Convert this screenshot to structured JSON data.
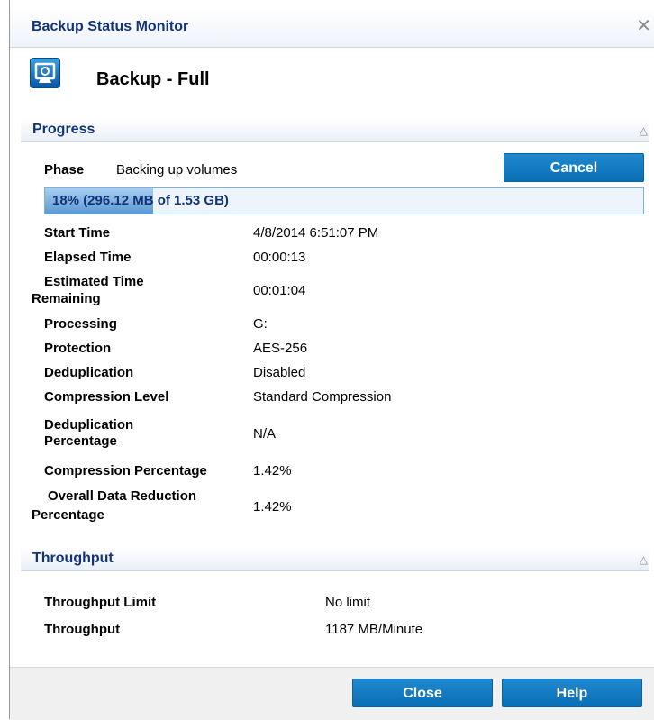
{
  "window": {
    "title": "Backup Status Monitor"
  },
  "header": {
    "title": "Backup - Full"
  },
  "progress_section": {
    "label": "Progress",
    "phase_label": "Phase",
    "phase_value": "Backing up volumes",
    "cancel_label": "Cancel",
    "progress_text": "18% (296.12 MB of 1.53 GB)",
    "progress_fraction": 0.18,
    "fields": [
      {
        "label": "Start Time",
        "value": "4/8/2014 6:51:07 PM"
      },
      {
        "label": "Elapsed Time",
        "value": "00:00:13"
      },
      {
        "label_line1": "Estimated Time",
        "label_line2": "Remaining",
        "value": "00:01:04"
      },
      {
        "label": "Processing",
        "value": "G:"
      },
      {
        "label": "Protection",
        "value": "AES-256"
      },
      {
        "label": "Deduplication",
        "value": "Disabled"
      },
      {
        "label": "Compression Level",
        "value": "Standard Compression"
      },
      {
        "label_line1": "Deduplication",
        "label_line2": "Percentage",
        "value": "N/A"
      },
      {
        "label": "Compression Percentage",
        "value": "1.42%"
      },
      {
        "label_line1": "Overall Data Reduction",
        "label_line2": "Percentage",
        "value": "1.42%"
      }
    ]
  },
  "throughput_section": {
    "label": "Throughput",
    "fields": [
      {
        "label": "Throughput Limit",
        "value": "No limit"
      },
      {
        "label": "Throughput",
        "value": "1187 MB/Minute"
      }
    ]
  },
  "footer": {
    "close_label": "Close",
    "help_label": "Help"
  },
  "colors": {
    "accent": "#0a6fb5",
    "title_text": "#12337a"
  },
  "icons": {
    "app": "backup-monitor-icon",
    "close": "close-icon",
    "collapse": "collapse-up-icon"
  }
}
